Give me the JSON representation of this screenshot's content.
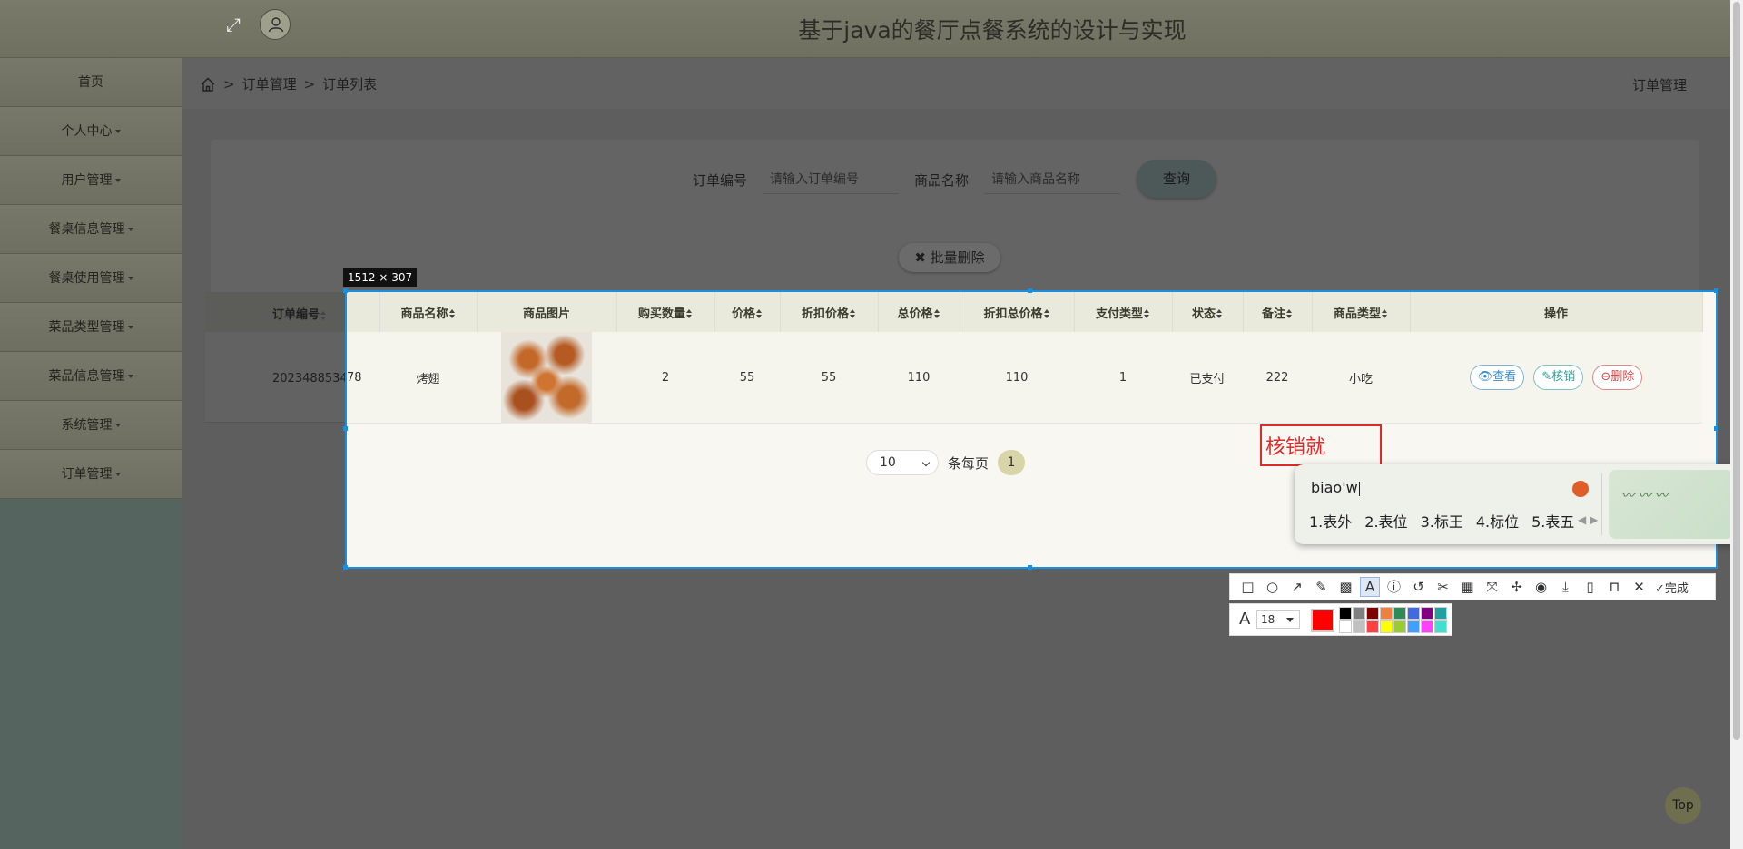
{
  "app": {
    "title": "基于java的餐厅点餐系统的设计与实现"
  },
  "sidebar": {
    "items": [
      {
        "label": "首页",
        "dropdown": false
      },
      {
        "label": "个人中心",
        "dropdown": true
      },
      {
        "label": "用户管理",
        "dropdown": true
      },
      {
        "label": "餐桌信息管理",
        "dropdown": true
      },
      {
        "label": "餐桌使用管理",
        "dropdown": true
      },
      {
        "label": "菜品类型管理",
        "dropdown": true
      },
      {
        "label": "菜品信息管理",
        "dropdown": true
      },
      {
        "label": "系统管理",
        "dropdown": true
      },
      {
        "label": "订单管理",
        "dropdown": true
      }
    ]
  },
  "breadcrumb": {
    "sep": ">",
    "level1": "订单管理",
    "level2": "订单列表",
    "right": "订单管理"
  },
  "search": {
    "order_label": "订单编号",
    "order_placeholder": "请输入订单编号",
    "product_label": "商品名称",
    "product_placeholder": "请输入商品名称",
    "query_button": "查询"
  },
  "batch_delete": "批量删除",
  "table": {
    "columns": [
      "订单编号",
      "商品名称",
      "商品图片",
      "购买数量",
      "价格",
      "折扣价格",
      "总价格",
      "折扣总价格",
      "支付类型",
      "状态",
      "备注",
      "商品类型",
      "操作"
    ],
    "row": {
      "order_no": "202348853478",
      "name": "烤翅",
      "qty": "2",
      "price": "55",
      "discount_price": "55",
      "total": "110",
      "discount_total": "110",
      "pay_type": "1",
      "status": "已支付",
      "remark": "222",
      "type": "小吃"
    },
    "actions": {
      "view": "查看",
      "verify": "核销",
      "delete": "删除"
    }
  },
  "pagination": {
    "page_size": "10",
    "page_size_suffix": "条每页",
    "current_page": "1"
  },
  "capture": {
    "size_label": "1512 × 307",
    "annotation_text": "核销就",
    "font_size": "18",
    "done_label": "完成",
    "current_color": "#ff0000",
    "palette": [
      "#000000",
      "#808080",
      "#800000",
      "#f08040",
      "#2e8b57",
      "#4169e1",
      "#800080",
      "#20a0a0",
      "#ffffff",
      "#c0c0c0",
      "#ff4040",
      "#ffff00",
      "#99cc33",
      "#40a0ff",
      "#ff40ff",
      "#40e0d0"
    ]
  },
  "ime": {
    "composition": "biao'w",
    "candidates": [
      "1.表外",
      "2.表位",
      "3.标王",
      "4.标位",
      "5.表五"
    ]
  },
  "top_button": "Top"
}
